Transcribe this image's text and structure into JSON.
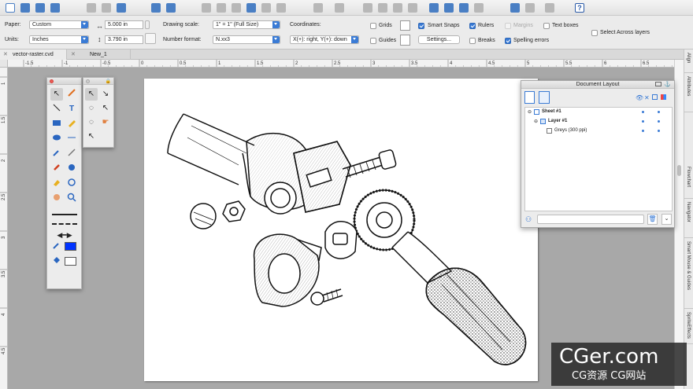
{
  "tabs": [
    {
      "label": "vector-raster.cvd",
      "active": true
    },
    {
      "label": "New_1",
      "active": false
    }
  ],
  "options": {
    "paper_label": "Paper:",
    "paper_value": "Custom",
    "width_value": "5.000 in",
    "units_label": "Units:",
    "units_value": "Inches",
    "height_value": "3.790 in",
    "drawing_scale_label": "Drawing scale:",
    "drawing_scale_value": "1\" = 1\"  (Full Size)",
    "number_format_label": "Number format:",
    "number_format_value": "N.xx3",
    "coordinates_label": "Coordinates:",
    "coordinates_value": "X(+): right, Y(+): down",
    "grids_label": "Grids",
    "guides_label": "Guides",
    "smart_snaps_label": "Smart Snaps",
    "settings_label": "Settings...",
    "rulers_label": "Rulers",
    "breaks_label": "Breaks",
    "margins_label": "Margins",
    "spelling_label": "Spelling errors",
    "text_boxes_label": "Text boxes",
    "select_across_label": "Select Across layers"
  },
  "checkboxes": {
    "grids": false,
    "guides": false,
    "smart_snaps": true,
    "rulers": true,
    "breaks": false,
    "margins": false,
    "spelling": true,
    "text_boxes": false,
    "select_across": false
  },
  "hruler_ticks": [
    "-1.5",
    "-1",
    "-0.5",
    "0",
    "0.5",
    "1",
    "1.5",
    "2",
    "2.5",
    "3",
    "3.5",
    "4",
    "4.5",
    "5",
    "5.5",
    "6",
    "6.5"
  ],
  "vruler_ticks": [
    "1",
    "1.5",
    "2",
    "2.5",
    "3",
    "3.5",
    "4",
    "4.5"
  ],
  "side_tabs": [
    "Align",
    "Attributes",
    "Flowchart",
    "Navigator",
    "Smart Mouse & Guides",
    "SpriteEffects"
  ],
  "doc_layout": {
    "title": "Document Layout",
    "sheet": "Sheet #1",
    "layer": "Layer #1",
    "image": "Greys (300 ppi)"
  },
  "watermark": {
    "brand": "CGer.com",
    "sub": "CG资源 CG网站"
  },
  "colors": {
    "accent": "#3a7bd5",
    "fill_swatch": "#0033ff",
    "close_red": "#ee5b55"
  }
}
